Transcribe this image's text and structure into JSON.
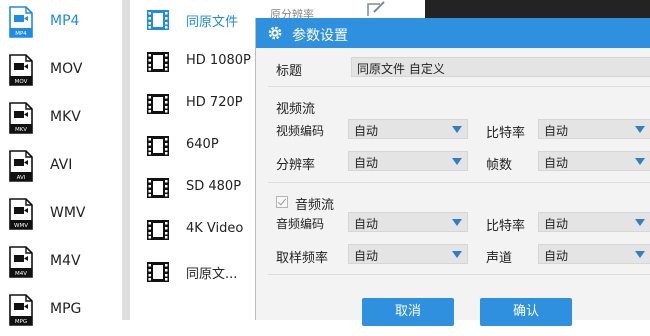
{
  "format_list": {
    "items": [
      {
        "label": "MP4",
        "badge": "MP4",
        "active": true
      },
      {
        "label": "MOV",
        "badge": "MOV"
      },
      {
        "label": "MKV",
        "badge": "MKV"
      },
      {
        "label": "AVI",
        "badge": "AVI"
      },
      {
        "label": "WMV",
        "badge": "WMV"
      },
      {
        "label": "M4V",
        "badge": "M4V"
      },
      {
        "label": "MPG",
        "badge": "MPG"
      }
    ]
  },
  "preset_list": {
    "items": [
      {
        "label": "同原文件",
        "active": true
      },
      {
        "label": "HD 1080P"
      },
      {
        "label": "HD 720P"
      },
      {
        "label": "640P"
      },
      {
        "label": "SD 480P"
      },
      {
        "label": "4K Video"
      },
      {
        "label": "同原文..."
      }
    ]
  },
  "background_row": {
    "partial_text": "原分辨率"
  },
  "dialog": {
    "title": "参数设置",
    "title_field": {
      "label": "标题",
      "value": "同原文件 自定义"
    },
    "video_section": {
      "heading": "视频流",
      "encoder": {
        "label": "视频编码",
        "value": "自动"
      },
      "bitrate": {
        "label": "比特率",
        "value": "自动"
      },
      "resolution": {
        "label": "分辨率",
        "value": "自动"
      },
      "framerate": {
        "label": "帧数",
        "value": "自动"
      }
    },
    "audio_section": {
      "heading": "音频流",
      "enabled": true,
      "encoder": {
        "label": "音频编码",
        "value": "自动"
      },
      "bitrate": {
        "label": "比特率",
        "value": "自动"
      },
      "samplerate": {
        "label": "取样频率",
        "value": "自动"
      },
      "channel": {
        "label": "声道",
        "value": "自动"
      }
    },
    "buttons": {
      "cancel": "取消",
      "confirm": "确认"
    }
  },
  "colors": {
    "accent": "#2f90df",
    "active_text": "#1e8be5"
  },
  "icons": [
    "file-format-icon",
    "film-strip-icon",
    "gear-icon",
    "edit-icon",
    "dropdown-arrow-icon",
    "checkbox-checked-icon"
  ]
}
